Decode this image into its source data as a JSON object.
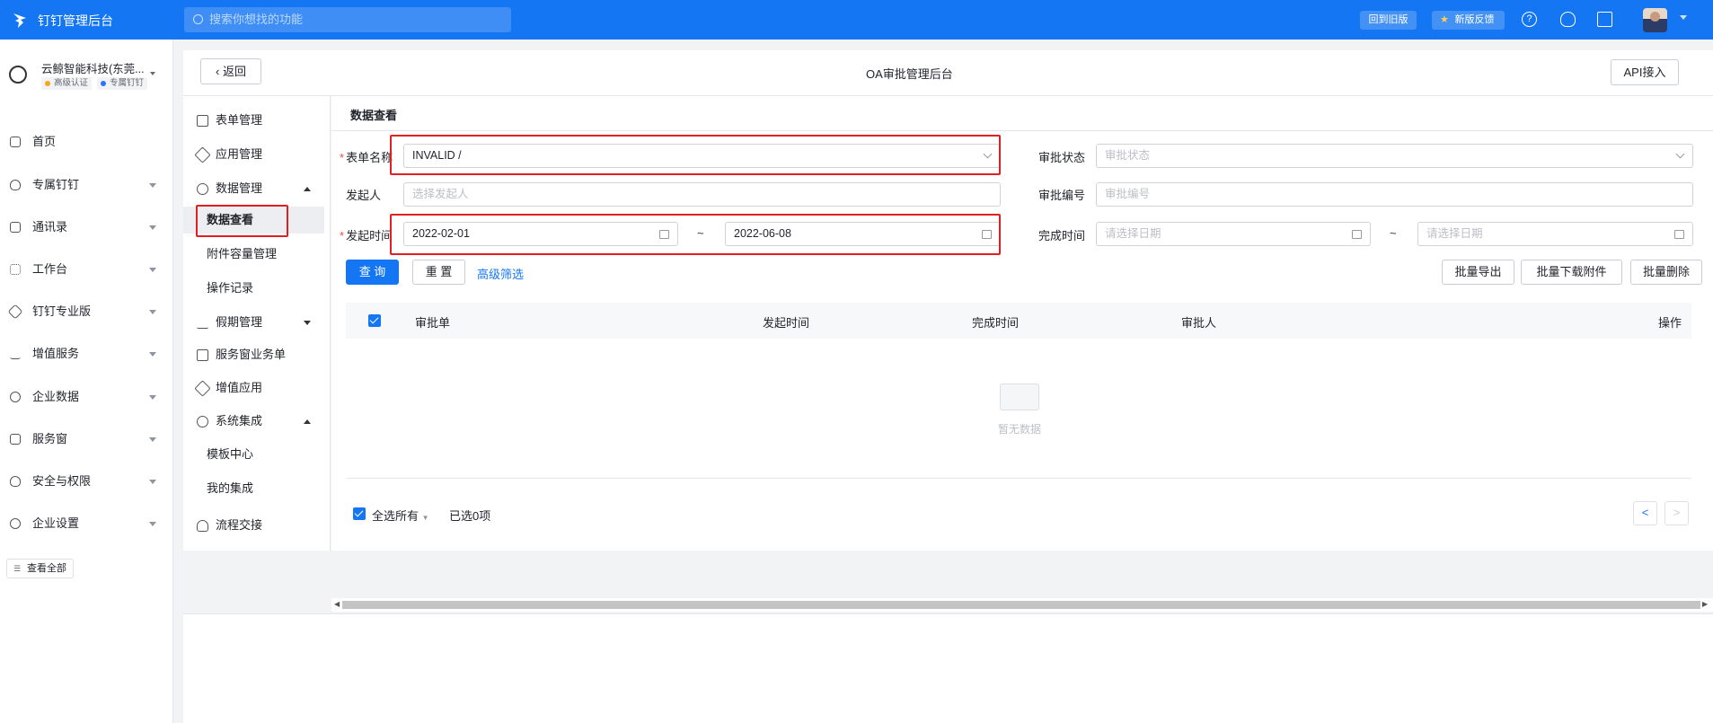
{
  "topbar": {
    "brand": "钉钉管理后台",
    "search_placeholder": "搜索你想找的功能",
    "back_old": "回到旧版",
    "feedback": "新版反馈"
  },
  "org": {
    "name": "云鲸智能科技(东莞...",
    "badge1": "高级认证",
    "badge2": "专属钉钉"
  },
  "nav": [
    {
      "label": "首页",
      "icon": "home-icon"
    },
    {
      "label": "专属钉钉",
      "icon": "shield-icon"
    },
    {
      "label": "通讯录",
      "icon": "contacts-icon"
    },
    {
      "label": "工作台",
      "icon": "grid-icon"
    },
    {
      "label": "钉钉专业版",
      "icon": "diamond-icon"
    },
    {
      "label": "增值服务",
      "icon": "trend-icon"
    },
    {
      "label": "企业数据",
      "icon": "chart-icon"
    },
    {
      "label": "服务窗",
      "icon": "window-icon"
    },
    {
      "label": "安全与权限",
      "icon": "lock-icon"
    },
    {
      "label": "企业设置",
      "icon": "gear-icon"
    }
  ],
  "view_all": "查看全部",
  "header": {
    "back": "返回",
    "title": "OA审批管理后台",
    "api": "API接入"
  },
  "subnav": {
    "form_mgmt": "表单管理",
    "app_mgmt": "应用管理",
    "data_mgmt": "数据管理",
    "data_view": "数据查看",
    "attach_mgmt": "附件容量管理",
    "op_log": "操作记录",
    "leave_mgmt": "假期管理",
    "service_order": "服务窗业务单",
    "value_app": "增值应用",
    "sys_integ": "系统集成",
    "template_center": "模板中心",
    "my_integ": "我的集成",
    "flow_handover": "流程交接"
  },
  "content": {
    "section_title": "数据查看",
    "form_name_label": "表单名称",
    "form_name_value": "INVALID /",
    "status_label": "审批状态",
    "status_placeholder": "审批状态",
    "initiator_label": "发起人",
    "initiator_placeholder": "选择发起人",
    "number_label": "审批编号",
    "number_placeholder": "审批编号",
    "start_label": "发起时间",
    "start_from": "2022-02-01",
    "start_to": "2022-06-08",
    "finish_label": "完成时间",
    "date_placeholder": "请选择日期",
    "tilde": "~",
    "query_btn": "查 询",
    "reset_btn": "重 置",
    "advanced": "高级筛选",
    "export_btn": "批量导出",
    "download_btn": "批量下载附件",
    "delete_btn": "批量删除",
    "cols": [
      "审批单",
      "发起时间",
      "完成时间",
      "审批人",
      "操作"
    ],
    "empty": "暂无数据",
    "select_all": "全选所有",
    "selected": "已选0项",
    "prev": "<",
    "next": ">"
  }
}
